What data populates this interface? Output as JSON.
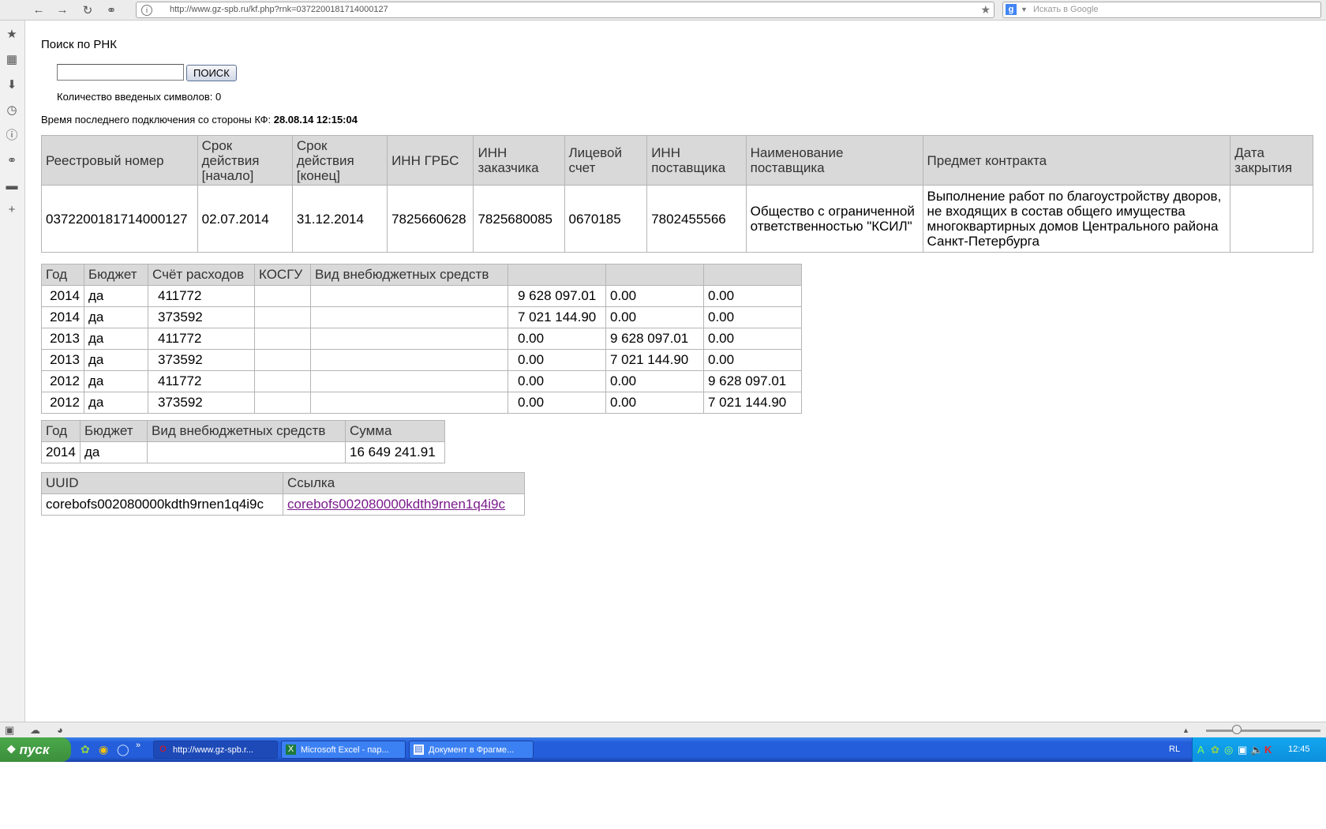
{
  "browser": {
    "url": "http://www.gz-spb.ru/kf.php?rnk=0372200181714000127",
    "search_placeholder": "Искать в Google"
  },
  "page": {
    "title": "Поиск по РНК",
    "search_input_value": "",
    "search_button_label": "ПОИСК",
    "char_count_label": "Количество введеных символов: 0",
    "last_connection_label": "Время последнего подключения со стороны КФ: ",
    "last_connection_value": "28.08.14 12:15:04"
  },
  "contract_table": {
    "headers": [
      "Реестровый номер",
      "Срок действия [начало]",
      "Срок действия [конец]",
      "ИНН ГРБС",
      "ИНН заказчика",
      "Лицевой счет",
      "ИНН поставщика",
      "Наименование поставщика",
      "Предмет контракта",
      "Дата закрытия"
    ],
    "row": [
      "0372200181714000127",
      "02.07.2014",
      "31.12.2014",
      "7825660628",
      "7825680085",
      "0670185",
      "7802455566",
      "Общество с ограниченной ответственностью \"КСИЛ\"",
      "Выполнение работ по благоустройству дворов, не входящих в состав общего имущества многоквартирных домов Центрального района Санкт-Петербурга",
      ""
    ]
  },
  "finance_table": {
    "headers": [
      "Год",
      "Бюджет",
      "Счёт расходов",
      "КОСГУ",
      "Вид внебюджетных средств",
      "",
      "",
      ""
    ],
    "rows": [
      [
        "2014",
        "да",
        "411772",
        "",
        "",
        "9 628 097.01",
        "0.00",
        "0.00"
      ],
      [
        "2014",
        "да",
        "373592",
        "",
        "",
        "7 021 144.90",
        "0.00",
        "0.00"
      ],
      [
        "2013",
        "да",
        "411772",
        "",
        "",
        "0.00",
        "9 628 097.01",
        "0.00"
      ],
      [
        "2013",
        "да",
        "373592",
        "",
        "",
        "0.00",
        "7 021 144.90",
        "0.00"
      ],
      [
        "2012",
        "да",
        "411772",
        "",
        "",
        "0.00",
        "0.00",
        "9 628 097.01"
      ],
      [
        "2012",
        "да",
        "373592",
        "",
        "",
        "0.00",
        "0.00",
        "7 021 144.90"
      ]
    ]
  },
  "sum_table": {
    "headers": [
      "Год",
      "Бюджет",
      "Вид внебюджетных средств",
      "Сумма"
    ],
    "row": [
      "2014",
      "да",
      "",
      "16 649 241.91"
    ]
  },
  "uuid_table": {
    "headers": [
      "UUID",
      "Ссылка"
    ],
    "row": [
      "corebofs002080000kdth9rnen1q4i9c",
      "corebofs002080000kdth9rnen1q4i9c"
    ]
  },
  "taskbar": {
    "start_label": "пуск",
    "tasks": [
      "http://www.gz-spb.r...",
      "Microsoft Excel - пар...",
      "Документ в Фрагме..."
    ],
    "language": "RL",
    "clock": "12:45"
  }
}
